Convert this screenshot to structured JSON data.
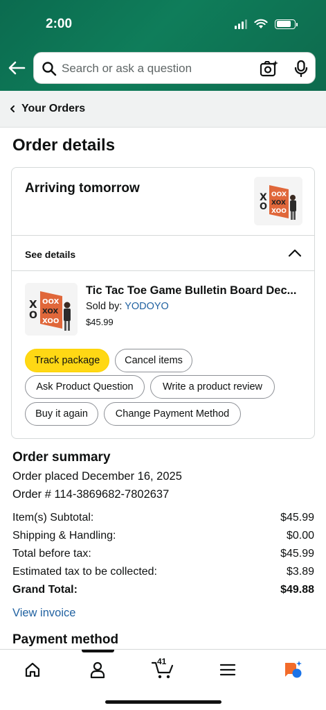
{
  "status_bar": {
    "time": "2:00"
  },
  "search": {
    "placeholder": "Search or ask a question"
  },
  "breadcrumb": {
    "label": "Your Orders"
  },
  "page": {
    "title": "Order details"
  },
  "shipment": {
    "status": "Arriving tomorrow",
    "details_label": "See details",
    "item": {
      "title": "Tic Tac Toe Game Bulletin Board Dec...",
      "sold_by_label": "Sold by:",
      "seller": "YODOYO",
      "price": "$45.99"
    },
    "actions": {
      "track": "Track package",
      "cancel": "Cancel items",
      "ask": "Ask Product Question",
      "review": "Write a product review",
      "buy_again": "Buy it again",
      "change_payment": "Change Payment Method"
    }
  },
  "summary": {
    "title": "Order summary",
    "placed": "Order placed December 16, 2025",
    "order_number": "Order # 114-3869682-7802637",
    "rows": [
      {
        "label": "Item(s) Subtotal:",
        "value": "$45.99"
      },
      {
        "label": "Shipping & Handling:",
        "value": "$0.00"
      },
      {
        "label": "Total before tax:",
        "value": "$45.99"
      },
      {
        "label": "Estimated tax to be collected:",
        "value": "$3.89"
      },
      {
        "label": "Grand Total:",
        "value": "$49.88"
      }
    ],
    "invoice_link": "View invoice"
  },
  "payment": {
    "title": "Payment method"
  },
  "bottom_nav": {
    "cart_count": "41"
  },
  "colors": {
    "header_green": "#0b6b4f",
    "primary_button": "#ffd814",
    "link_blue": "#2162a1",
    "board_orange": "#e0673a"
  }
}
